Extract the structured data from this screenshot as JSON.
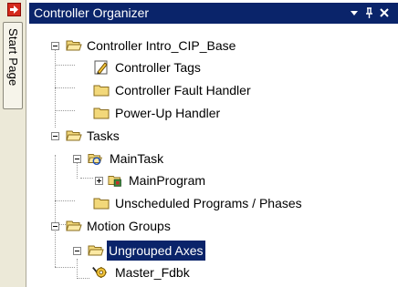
{
  "sidebar": {
    "start_page_tab": "Start Page"
  },
  "panel": {
    "title": "Controller Organizer",
    "buttons": {
      "dropdown_icon": "dropdown-arrow",
      "pin_icon": "pushpin",
      "close_icon": "close-x"
    }
  },
  "tree": {
    "controller": {
      "label": "Controller Intro_CIP_Base",
      "children": [
        {
          "label": "Controller Tags",
          "icon": "tags-pencil-icon"
        },
        {
          "label": "Controller Fault Handler",
          "icon": "folder-icon"
        },
        {
          "label": "Power-Up Handler",
          "icon": "folder-icon"
        }
      ]
    },
    "tasks": {
      "label": "Tasks",
      "main_task": "MainTask",
      "main_program": "MainProgram",
      "unscheduled": "Unscheduled Programs / Phases"
    },
    "motion_groups": {
      "label": "Motion Groups",
      "ungrouped_axes": "Ungrouped Axes",
      "axis": "Master_Fdbk"
    }
  },
  "colors": {
    "title_bg": "#0a246a",
    "selection_bg": "#0a246a",
    "folder_yellow": "#f2d87a",
    "sidebar_bg": "#ece9d8"
  }
}
